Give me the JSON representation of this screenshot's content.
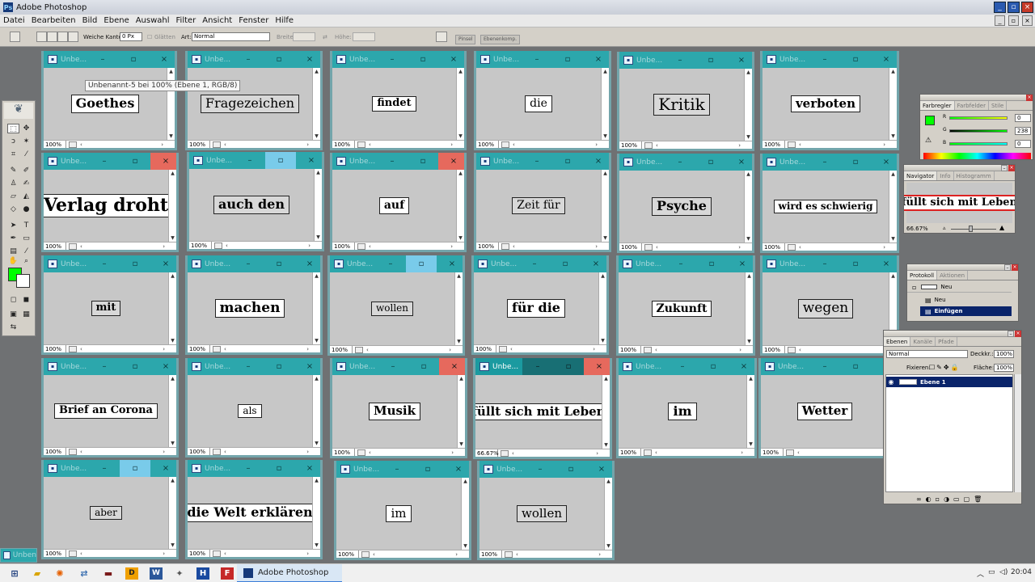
{
  "app": {
    "title": "Adobe Photoshop",
    "window_controls": [
      "_",
      "▫",
      "×"
    ]
  },
  "menu": [
    "Datei",
    "Bearbeiten",
    "Bild",
    "Ebene",
    "Auswahl",
    "Filter",
    "Ansicht",
    "Fenster",
    "Hilfe"
  ],
  "options_bar": {
    "feather_label": "Weiche Kante:",
    "feather_value": "0 Px",
    "antialias_label": "Glätten",
    "style_label": "Art:",
    "style_value": "Normal",
    "width_label": "Breite:",
    "height_label": "Höhe:",
    "well_tabs": [
      "Pinsel",
      "Ebenenkomp."
    ]
  },
  "tooltip": "Unbenannt-5 bei 100% (Ebene 1, RGB/8)",
  "colors": {
    "foreground": "#00ff00",
    "background": "#ffffff",
    "window_titlebar": "#1b9aa0",
    "close_hover": "#e6695d",
    "max_hover": "#79cbea"
  },
  "windows": [
    {
      "title": "Unbe...",
      "zoom": "100%",
      "word": "Goethes",
      "style": "bold"
    },
    {
      "title": "Unbe...",
      "zoom": "100%",
      "word": "Fragezeichen",
      "style": "grey"
    },
    {
      "title": "Unbe...",
      "zoom": "100%",
      "word": "findet",
      "style": "bold"
    },
    {
      "title": "Unbe...",
      "zoom": "100%",
      "word": "die",
      "style": "plain"
    },
    {
      "title": "Unbe...",
      "zoom": "100%",
      "word": "Kritik",
      "style": "grey"
    },
    {
      "title": "Unbe...",
      "zoom": "100%",
      "word": "verboten",
      "style": "bold"
    },
    {
      "title": "Unbe...",
      "zoom": "100%",
      "word": "Verlag droht",
      "style": "bold"
    },
    {
      "title": "Unbe...",
      "zoom": "100%",
      "word": "auch den",
      "style": "greybold"
    },
    {
      "title": "Unbe...",
      "zoom": "100%",
      "word": "auf",
      "style": "bold"
    },
    {
      "title": "Unbe...",
      "zoom": "100%",
      "word": "Zeit für",
      "style": "grey"
    },
    {
      "title": "Unbe...",
      "zoom": "100%",
      "word": "Psyche",
      "style": "greybold"
    },
    {
      "title": "Unbe...",
      "zoom": "100%",
      "word": "wird es schwierig",
      "style": "bold"
    },
    {
      "title": "Unbe...",
      "zoom": "100%",
      "word": "mit",
      "style": "greybold"
    },
    {
      "title": "Unbe...",
      "zoom": "100%",
      "word": "machen",
      "style": "bold"
    },
    {
      "title": "Unbe...",
      "zoom": "100%",
      "word": "wollen",
      "style": "grey"
    },
    {
      "title": "Unbe...",
      "zoom": "100%",
      "word": "für die",
      "style": "bold"
    },
    {
      "title": "Unbe...",
      "zoom": "100%",
      "word": "Zukunft",
      "style": "bold"
    },
    {
      "title": "Unbe...",
      "zoom": "100%",
      "word": "wegen",
      "style": "grey"
    },
    {
      "title": "Unbe...",
      "zoom": "100%",
      "word": "Brief an Corona",
      "style": "bold"
    },
    {
      "title": "Unbe...",
      "zoom": "100%",
      "word": "als",
      "style": "plain"
    },
    {
      "title": "Unbe...",
      "zoom": "100%",
      "word": "Musik",
      "style": "bold"
    },
    {
      "title": "Unbe...",
      "zoom": "66.67%",
      "word": "füllt sich mit Leben",
      "style": "bold"
    },
    {
      "title": "Unbe...",
      "zoom": "100%",
      "word": "im",
      "style": "bold"
    },
    {
      "title": "Unbe...",
      "zoom": "100%",
      "word": "Wetter",
      "style": "bold"
    },
    {
      "title": "Unbe...",
      "zoom": "100%",
      "word": "aber",
      "style": "grey"
    },
    {
      "title": "Unbe...",
      "zoom": "100%",
      "word": "die Welt erklären",
      "style": "bold"
    },
    {
      "title": "Unbe...",
      "zoom": "100%",
      "word": "im",
      "style": "plain"
    },
    {
      "title": "Unbe...",
      "zoom": "100%",
      "word": "wollen",
      "style": "grey"
    }
  ],
  "color_palette": {
    "tabs": [
      "Farbregler",
      "Farbfelder",
      "Stile"
    ],
    "channels": [
      {
        "name": "R",
        "value": "0"
      },
      {
        "name": "G",
        "value": "238"
      },
      {
        "name": "B",
        "value": "0"
      }
    ]
  },
  "navigator": {
    "tabs": [
      "Navigator",
      "Info",
      "Histogramm"
    ],
    "preview_text": "füllt sich mit Leben",
    "zoom": "66.67%"
  },
  "history": {
    "tabs": [
      "Protokoll",
      "Aktionen"
    ],
    "items": [
      "Neu",
      "Neu",
      "Einfügen"
    ]
  },
  "layers": {
    "tabs": [
      "Ebenen",
      "Kanäle",
      "Pfade"
    ],
    "blend": "Normal",
    "opacity_label": "Deckkr.:",
    "opacity": "100%",
    "lock_label": "Fixieren:",
    "fill_label": "Fläche:",
    "fill": "100%",
    "layer_name": "Ebene 1"
  },
  "minimized_window": "Unben",
  "taskbar": {
    "active_app": "Adobe Photoshop",
    "time": "20:04"
  }
}
